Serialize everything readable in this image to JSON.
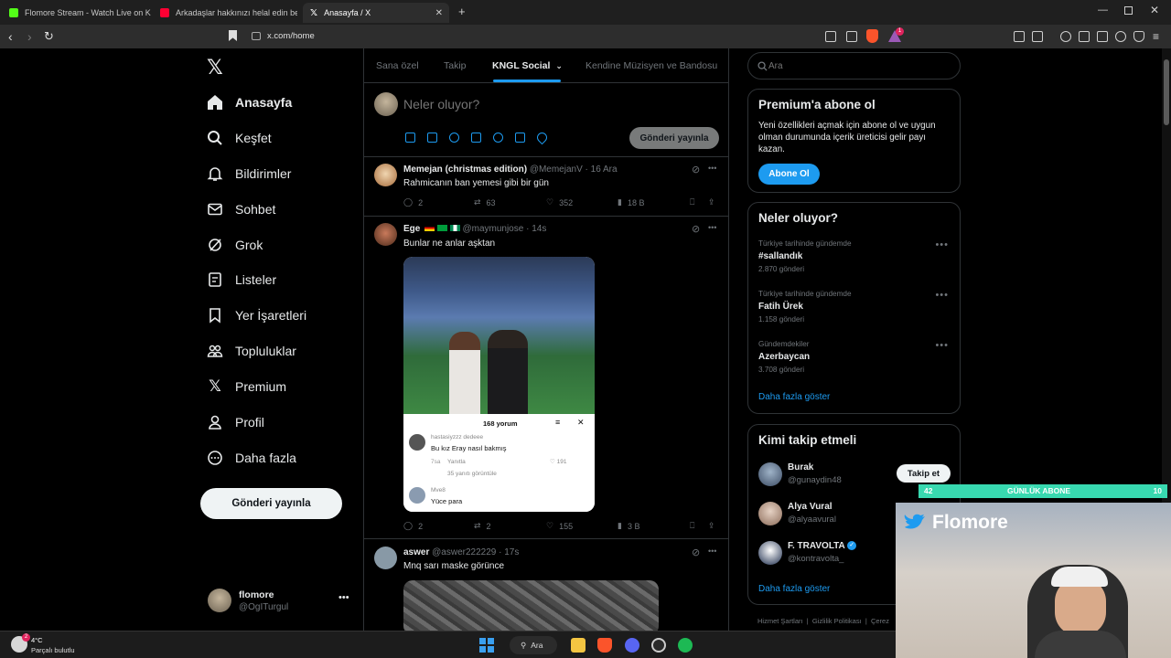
{
  "browser": {
    "tabs": [
      {
        "title": "Flomore Stream - Watch Live on Kick",
        "color": "#53fc18"
      },
      {
        "title": "Arkadaşlar hakkınızı helal edin ben gi",
        "color": "#ff0033"
      },
      {
        "title": "Anasayfa / X",
        "color": "#ffffff"
      }
    ],
    "url": "x.com/home",
    "brave_badge": "1"
  },
  "sidebar": {
    "items": [
      {
        "label": "Anasayfa",
        "icon": "home-icon"
      },
      {
        "label": "Keşfet",
        "icon": "search-icon"
      },
      {
        "label": "Bildirimler",
        "icon": "bell-icon"
      },
      {
        "label": "Sohbet",
        "icon": "mail-icon"
      },
      {
        "label": "Grok",
        "icon": "grok-icon"
      },
      {
        "label": "Listeler",
        "icon": "list-icon"
      },
      {
        "label": "Yer İşaretleri",
        "icon": "bookmark-icon"
      },
      {
        "label": "Topluluklar",
        "icon": "communities-icon"
      },
      {
        "label": "Premium",
        "icon": "x-logo-icon"
      },
      {
        "label": "Profil",
        "icon": "person-icon"
      },
      {
        "label": "Daha fazla",
        "icon": "more-circle-icon"
      }
    ],
    "post_button": "Gönderi yayınla",
    "account": {
      "name": "flomore",
      "handle": "@OgITurgul"
    }
  },
  "feed": {
    "tabs": [
      "Sana özel",
      "Takip",
      "KNGL Social",
      "Kendine Müzisyen ve Bandosu"
    ],
    "compose": {
      "placeholder": "Neler oluyor?",
      "button": "Gönderi yayınla"
    },
    "posts": [
      {
        "name": "Memejan (christmas edition)",
        "handle": "@MemejanV",
        "time": "· 16 Ara",
        "text": "Rahmicanın ban yemesi gibi bir gün",
        "replies": "2",
        "reposts": "63",
        "likes": "352",
        "views": "18 B"
      },
      {
        "name": "Ege",
        "handle": "@maymunjose",
        "time": "· 14s",
        "text": "Bunlar ne anlar aşktan",
        "replies": "2",
        "reposts": "2",
        "likes": "155",
        "views": "3 B",
        "embed": {
          "comments_title": "168 yorum",
          "c1_user": "hastasiyzzz dedeee",
          "c1_text": "Bu kız Eray nasıl bakmış",
          "c1_time": "7sa",
          "c1_reply": "Yanıtla",
          "c1_likes": "191",
          "c1_more": "35 yanıtı görüntüle",
          "c2_user": "Mve8",
          "c2_text": "Yüce para"
        }
      },
      {
        "name": "aswer",
        "handle": "@aswer222229",
        "time": "· 17s",
        "text": "Mnq sarı maske görünce"
      }
    ]
  },
  "right": {
    "search_placeholder": "Ara",
    "premium": {
      "title": "Premium'a abone ol",
      "text": "Yeni özellikleri açmak için abone ol ve uygun olman durumunda içerik üreticisi gelir payı kazan.",
      "button": "Abone Ol"
    },
    "trends_title": "Neler oluyor?",
    "trends": [
      {
        "context": "Türkiye tarihinde gündemde",
        "name": "#sallandık",
        "count": "2.870 gönderi"
      },
      {
        "context": "Türkiye tarihinde gündemde",
        "name": "Fatih Ürek",
        "count": "1.158 gönderi"
      },
      {
        "context": "Gündemdekiler",
        "name": "Azerbaycan",
        "count": "3.708 gönderi"
      }
    ],
    "trends_more": "Daha fazla göster",
    "who_title": "Kimi takip etmeli",
    "who": [
      {
        "name": "Burak",
        "handle": "@gunaydin48"
      },
      {
        "name": "Alya Vural",
        "handle": "@alyaavural"
      },
      {
        "name": "F. TRAVOLTA",
        "handle": "@kontravolta_"
      }
    ],
    "follow_button": "Takip et",
    "who_more": "Daha fazla göster",
    "footer": [
      "Hizmet Şartları",
      "Gizlilik Politikası",
      "Çerez"
    ]
  },
  "taskbar": {
    "weather_temp": "4°C",
    "weather_desc": "Parçalı bulutlu",
    "search": "Ara",
    "badge_count": "2"
  },
  "overlay": {
    "sub_left": "42",
    "sub_title": "GÜNLÜK ABONE",
    "sub_right": "10",
    "streamer": "Flomore"
  },
  "colors": {
    "accent": "#1d9bf0",
    "background": "#000000",
    "border": "#2f3336",
    "muted": "#71767b"
  }
}
